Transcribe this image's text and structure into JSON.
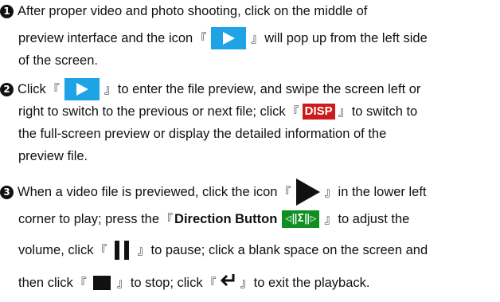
{
  "steps": [
    {
      "number": "1",
      "lines": [
        [
          "After proper video and photo shooting, click on the middle of"
        ],
        [
          "preview interface and the icon",
          "will pop up from the left side"
        ],
        [
          "of the screen."
        ]
      ]
    },
    {
      "number": "2",
      "lines": [
        [
          "Click",
          "to enter the file preview, and swipe the screen left or"
        ],
        [
          "right to switch to the previous or next file; click",
          "to switch to"
        ],
        [
          "the full-screen preview or display the detailed information of the"
        ],
        [
          "preview file."
        ]
      ]
    },
    {
      "number": "3",
      "lines": [
        [
          "When a video file is previewed, click the icon",
          "in the lower left"
        ],
        [
          "corner to play; press the",
          "to adjust the"
        ],
        [
          "volume, click",
          "to pause; click a blank space on the screen and"
        ],
        [
          "then click",
          "to stop; click",
          "to exit the playback."
        ]
      ]
    }
  ],
  "labels": {
    "disp": "DISP",
    "direction_button": "Direction Button",
    "direction_glyph": "◁‖Σ‖▷",
    "bracket_open": "『",
    "bracket_close": "』"
  },
  "icons": {
    "play_preview": "play-icon-blue",
    "play_video": "play-icon-black",
    "pause": "pause-icon",
    "stop": "stop-icon",
    "exit": "return-arrow-icon",
    "direction": "direction-button-icon"
  },
  "colors": {
    "play_button_bg": "#1da3e6",
    "disp_bg": "#cc1b1b",
    "direction_bg": "#0e8f1f",
    "text": "#111111"
  }
}
